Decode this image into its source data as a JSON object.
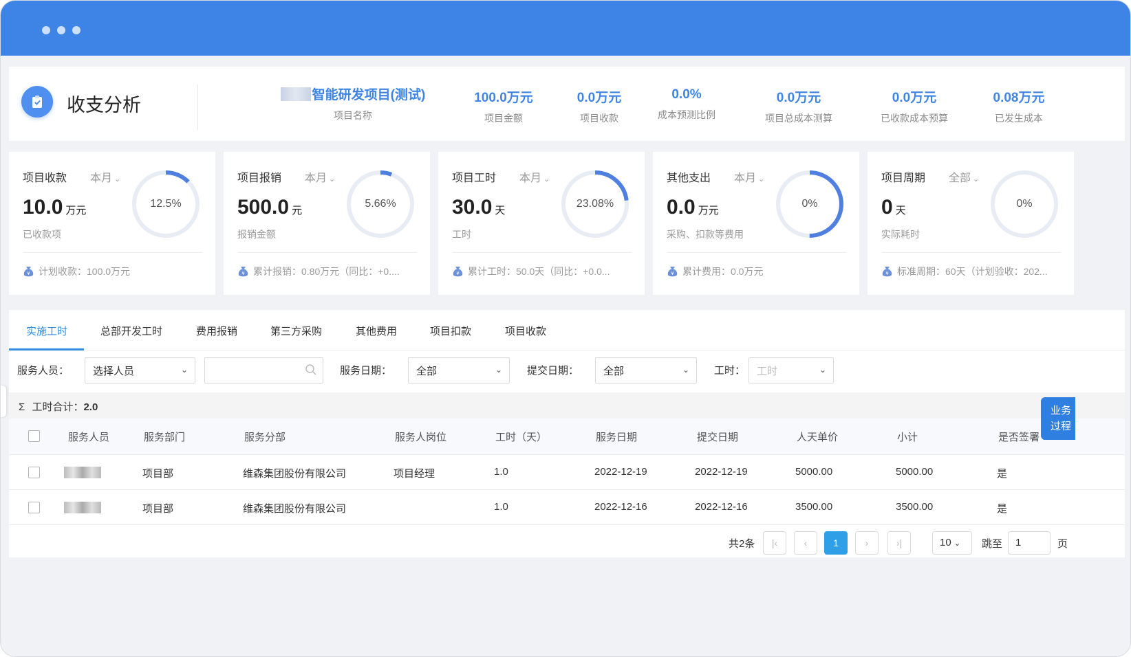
{
  "header": {
    "app_title": "收支分析",
    "project_name": "智能研发项目(测试)",
    "project_caption": "项目名称",
    "kpis": [
      {
        "value": "100.0万元",
        "caption": "项目金额"
      },
      {
        "value": "0.0万元",
        "caption": "项目收款"
      },
      {
        "value": "0.0%",
        "caption": "成本预测比例"
      },
      {
        "value": "0.0万元",
        "caption": "项目总成本测算"
      },
      {
        "value": "0.0万元",
        "caption": "已收款成本预算"
      },
      {
        "value": "0.08万元",
        "caption": "已发生成本"
      }
    ]
  },
  "cards": [
    {
      "title": "项目收款",
      "period": "本月",
      "value": "10.0",
      "unit": "万元",
      "sub": "已收款项",
      "percent_text": "12.5%",
      "percent": 12.5,
      "footer": "计划收款：100.0万元"
    },
    {
      "title": "项目报销",
      "period": "本月",
      "value": "500.0",
      "unit": "元",
      "sub": "报销金额",
      "percent_text": "5.66%",
      "percent": 5.66,
      "footer": "累计报销：0.80万元（同比：+0...."
    },
    {
      "title": "项目工时",
      "period": "本月",
      "value": "30.0",
      "unit": "天",
      "sub": "工时",
      "percent_text": "23.08%",
      "percent": 23.08,
      "footer": "累计工时：50.0天（同比：+0.0..."
    },
    {
      "title": "其他支出",
      "period": "本月",
      "value": "0.0",
      "unit": "万元",
      "sub": "采购、扣款等费用",
      "percent_text": "0%",
      "percent": 50,
      "footer": "累计费用：0.0万元"
    },
    {
      "title": "项目周期",
      "period": "全部",
      "value": "0",
      "unit": "天",
      "sub": "实际耗时",
      "percent_text": "0%",
      "percent": 0,
      "footer": "标准周期：60天（计划验收：202..."
    }
  ],
  "tabs": [
    "实施工时",
    "总部开发工时",
    "费用报销",
    "第三方采购",
    "其他费用",
    "项目扣款",
    "项目收款"
  ],
  "filters": {
    "service_person_label": "服务人员：",
    "service_person_value": "选择人员",
    "search_placeholder": "",
    "service_date_label": "服务日期：",
    "service_date_value": "全部",
    "submit_date_label": "提交日期：",
    "submit_date_value": "全部",
    "hours_label": "工时：",
    "hours_placeholder": "工时"
  },
  "summary": {
    "label": "工时合计：",
    "value": "2.0"
  },
  "table": {
    "columns": [
      "服务人员",
      "服务部门",
      "服务分部",
      "服务人岗位",
      "工时（天）",
      "服务日期",
      "提交日期",
      "人天单价",
      "小计",
      "是否签署"
    ],
    "rows": [
      {
        "dept": "项目部",
        "branch": "维森集团股份有限公司",
        "position": "项目经理",
        "hours": "1.0",
        "service_date": "2022-12-19",
        "submit_date": "2022-12-19",
        "unit_price": "5000.00",
        "subtotal": "5000.00",
        "signed": "是"
      },
      {
        "dept": "项目部",
        "branch": "维森集团股份有限公司",
        "position": "",
        "hours": "1.0",
        "service_date": "2022-12-16",
        "submit_date": "2022-12-16",
        "unit_price": "3500.00",
        "subtotal": "3500.00",
        "signed": "是"
      }
    ]
  },
  "pagination": {
    "total": "共2条",
    "current": "1",
    "page_size": "10",
    "jump_label": "跳至",
    "jump_value": "1",
    "page_label": "页"
  },
  "side_tab": {
    "line1": "业务",
    "line2": "过程"
  },
  "colors": {
    "titlebar": "#3d84e6",
    "accent": "#3d84e6",
    "ring": "#4f80e0",
    "ring_track": "#e8ecf4",
    "tab_active": "#2f8ce0"
  }
}
